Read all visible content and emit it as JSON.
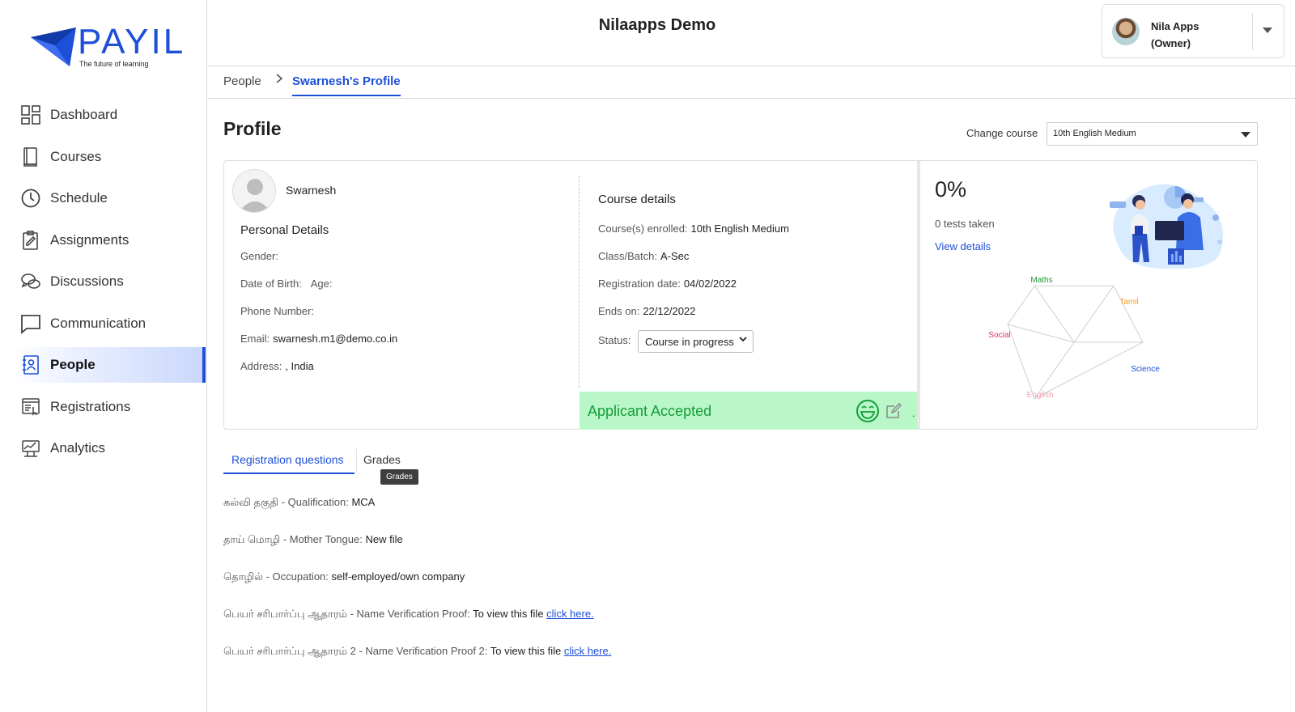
{
  "brand": {
    "name": "PAYIL",
    "tagline": "The future of learning"
  },
  "sidebar": {
    "items": [
      {
        "label": "Dashboard",
        "icon": "dashboard-icon"
      },
      {
        "label": "Courses",
        "icon": "book-icon"
      },
      {
        "label": "Schedule",
        "icon": "clock-icon"
      },
      {
        "label": "Assignments",
        "icon": "clipboard-icon"
      },
      {
        "label": "Discussions",
        "icon": "chat-bubbles-icon"
      },
      {
        "label": "Communication",
        "icon": "message-icon"
      },
      {
        "label": "People",
        "icon": "contact-book-icon",
        "active": true
      },
      {
        "label": "Registrations",
        "icon": "registration-form-icon"
      },
      {
        "label": "Analytics",
        "icon": "analytics-icon"
      }
    ]
  },
  "header": {
    "title": "Nilaapps Demo",
    "user": {
      "name": "Nila Apps",
      "role": "(Owner)"
    }
  },
  "breadcrumb": {
    "parent": "People",
    "current": "Swarnesh's Profile"
  },
  "page": {
    "title": "Profile",
    "change_course_label": "Change course",
    "selected_course": "10th English Medium"
  },
  "profile": {
    "name": "Swarnesh",
    "personal_heading": "Personal Details",
    "gender_label": "Gender:",
    "gender_value": "",
    "dob_label": "Date of Birth:",
    "age_label": "Age:",
    "phone_label": "Phone Number:",
    "email_label": "Email:",
    "email_value": "swarnesh.m1@demo.co.in",
    "address_label": "Address:",
    "address_value": ", India"
  },
  "course_details": {
    "heading": "Course details",
    "enrolled_label": "Course(s) enrolled:",
    "enrolled_value": "10th English Medium",
    "batch_label": "Class/Batch:",
    "batch_value": "A-Sec",
    "reg_date_label": "Registration date:",
    "reg_date_value": "04/02/2022",
    "ends_label": "Ends on:",
    "ends_value": "22/12/2022",
    "status_label": "Status:",
    "status_value": "Course in progress"
  },
  "applicant_status": {
    "text": "Applicant Accepted",
    "color": "#149c3a",
    "bg": "#b9f7c8"
  },
  "stats": {
    "percent": "0%",
    "tests_taken": "0 tests taken",
    "view_details": "View details"
  },
  "chart_data": {
    "type": "radar",
    "categories": [
      "Maths",
      "Tamil",
      "Science",
      "English",
      "Social"
    ],
    "values": [
      0,
      0,
      0,
      0,
      0
    ],
    "colors": [
      "#1f9a2e",
      "#f0a030",
      "#1d4fd8",
      "#f4a0b0",
      "#e0306a"
    ]
  },
  "tabs": {
    "registration": "Registration questions",
    "grades": "Grades",
    "tooltip": "Grades"
  },
  "questions": [
    {
      "label": "கல்வி தகுதி - Qualification:",
      "value": "MCA",
      "link": ""
    },
    {
      "label": "தாய் மொழி - Mother Tongue:",
      "value": "New file",
      "link": ""
    },
    {
      "label": "தொழில் - Occupation:",
      "value": "self-employed/own company",
      "link": ""
    },
    {
      "label": "பெயர் சரிபார்ப்பு ஆதாரம் - Name Verification Proof:",
      "value": "To view this file",
      "link": "click here."
    },
    {
      "label": "பெயர் சரிபார்ப்பு ஆதாரம் 2 - Name Verification Proof 2:",
      "value": "To view this file",
      "link": "click here."
    }
  ],
  "colors": {
    "accent": "#1d4fd8"
  }
}
